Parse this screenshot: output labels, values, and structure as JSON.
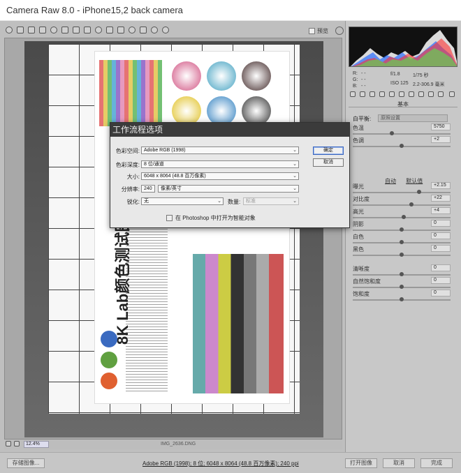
{
  "window": {
    "title": "Camera Raw 8.0 -  iPhone15,2 back camera"
  },
  "toolbar": {
    "tools": [
      "zoom-icon",
      "hand-icon",
      "white-balance-icon",
      "color-sampler-icon",
      "targeted-adjust-icon",
      "crop-icon",
      "straighten-icon",
      "spot-removal-icon",
      "red-eye-icon",
      "adjustment-brush-icon",
      "graduated-filter-icon",
      "radial-filter-icon",
      "preferences-icon",
      "rotate-left-icon",
      "rotate-right-icon"
    ],
    "preview_label": "预览"
  },
  "filmstrip": {
    "zoom": "12.4%",
    "filename": "IMG_2636.DNG"
  },
  "bottom": {
    "save_label": "存储图像...",
    "workflow_link": "Adobe RGB (1998); 8 位; 6048 x 8064 (48.8 百万像素); 240 ppi",
    "open_label": "打开图像",
    "cancel_label": "取消",
    "done_label": "完成"
  },
  "camera_info": {
    "r": "R:",
    "g": "G:",
    "b": "B:",
    "r_val": "- -",
    "g_val": "- -",
    "b_val": "- -",
    "aperture": "f/1.8",
    "shutter": "1/75 秒",
    "iso": "ISO 125",
    "lens": "2.2-306.9 毫米"
  },
  "panel": {
    "title": "基本",
    "white_balance_label": "白平衡:",
    "white_balance_value": "原照设置",
    "auto_label": "自动",
    "default_label": "默认值",
    "sliders": [
      {
        "label": "色温",
        "value": "5750",
        "pos": 0.4
      },
      {
        "label": "色调",
        "value": "+2",
        "pos": 0.5
      },
      {
        "label": "曝光",
        "value": "+2.15",
        "pos": 0.68
      },
      {
        "label": "对比度",
        "value": "+22",
        "pos": 0.6
      },
      {
        "label": "高光",
        "value": "+4",
        "pos": 0.52
      },
      {
        "label": "阴影",
        "value": "0",
        "pos": 0.5
      },
      {
        "label": "白色",
        "value": "0",
        "pos": 0.5
      },
      {
        "label": "黑色",
        "value": "0",
        "pos": 0.5
      },
      {
        "label": "清晰度",
        "value": "0",
        "pos": 0.5
      },
      {
        "label": "自然饱和度",
        "value": "0",
        "pos": 0.5
      },
      {
        "label": "饱和度",
        "value": "0",
        "pos": 0.5
      }
    ]
  },
  "dialog": {
    "title": "工作流程选项",
    "color_space_label": "色彩空间:",
    "color_space": "Adobe RGB (1998)",
    "depth_label": "色彩深度:",
    "depth": "8 位/通道",
    "size_label": "大小:",
    "size": "6048 x 8064 (48.8 百万像素)",
    "resolution_label": "分辨率:",
    "resolution": "240",
    "resolution_unit": "像素/英寸",
    "sharpen_label": "锐化:",
    "sharpen": "无",
    "amount_label": "数量:",
    "amount": "标准",
    "smart_object_label": "在 Photoshop 中打开为智能对象",
    "ok_label": "确定",
    "cancel_label": "取消"
  },
  "photo": {
    "chart_heading": "8K Lab颜色测试图"
  }
}
